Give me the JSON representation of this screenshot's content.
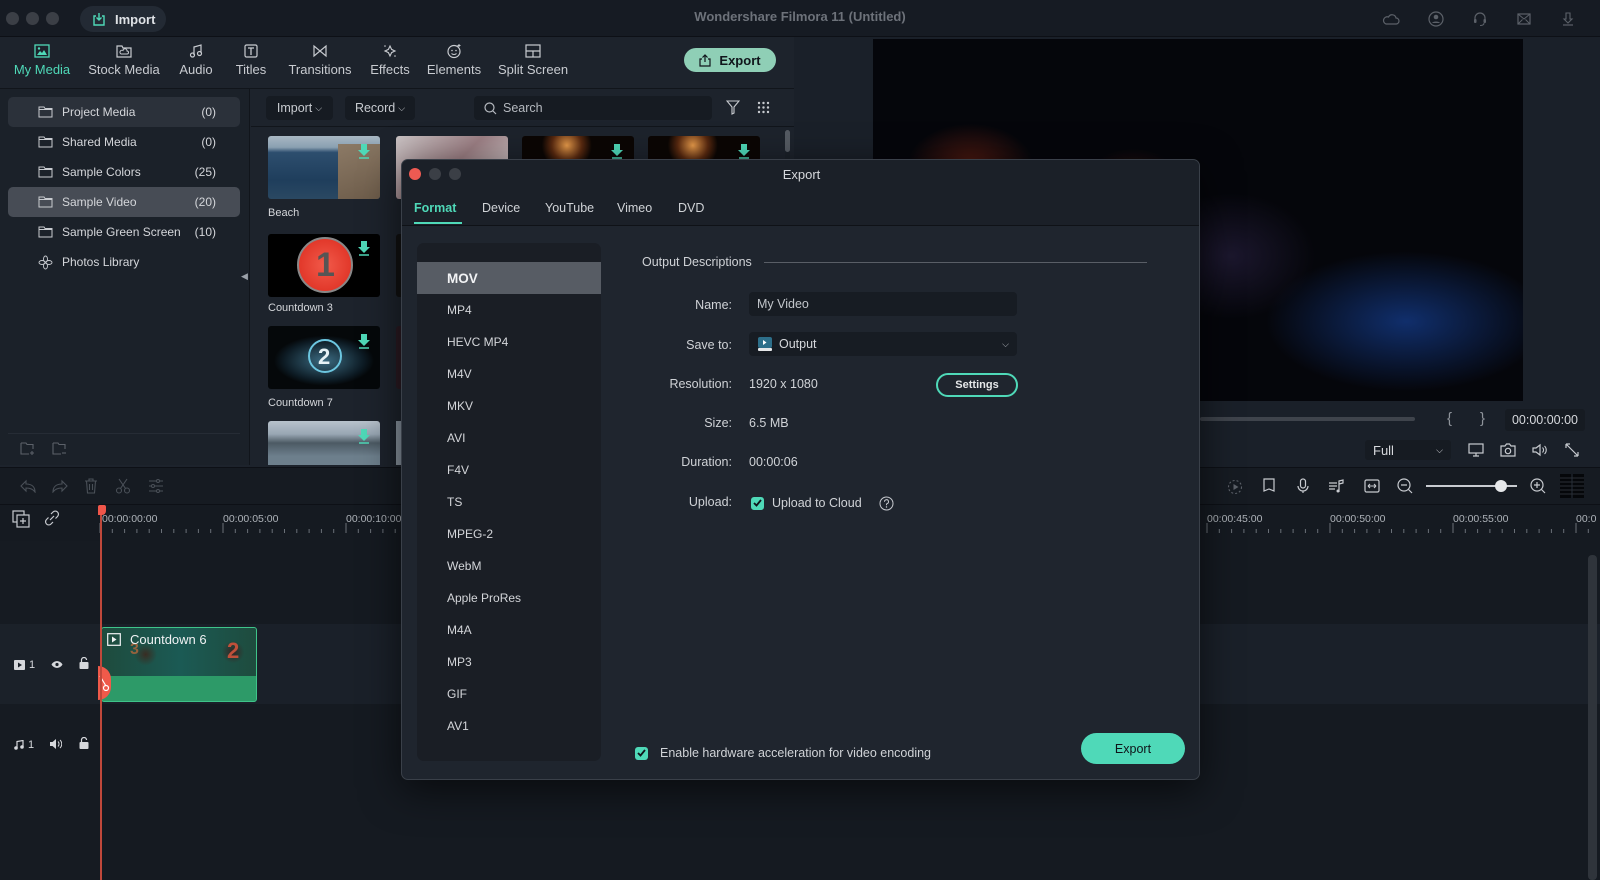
{
  "app": {
    "title": "Wondershare Filmora 11 (Untitled)",
    "import_label": "Import",
    "export_label": "Export"
  },
  "media_tabs": [
    {
      "label": "My Media",
      "icon": "image-icon",
      "active": true
    },
    {
      "label": "Stock Media",
      "icon": "cloud-folder-icon"
    },
    {
      "label": "Audio",
      "icon": "music-note-icon"
    },
    {
      "label": "Titles",
      "icon": "text-t-icon"
    },
    {
      "label": "Transitions",
      "icon": "transition-bowtie-icon"
    },
    {
      "label": "Effects",
      "icon": "sparkle-icon"
    },
    {
      "label": "Elements",
      "icon": "smiley-sticker-icon"
    },
    {
      "label": "Split Screen",
      "icon": "split-layout-icon"
    }
  ],
  "folders": [
    {
      "label": "Project Media",
      "count": "(0)"
    },
    {
      "label": "Shared Media",
      "count": "(0)"
    },
    {
      "label": "Sample Colors",
      "count": "(25)"
    },
    {
      "label": "Sample Video",
      "count": "(20)"
    },
    {
      "label": "Sample Green Screen",
      "count": "(10)"
    },
    {
      "label": "Photos Library",
      "count": ""
    }
  ],
  "media_toolbar": {
    "import_label": "Import",
    "record_label": "Record",
    "search_placeholder": "Search"
  },
  "media_items": [
    {
      "label": "Beach"
    },
    {
      "label": "Countdown 3"
    },
    {
      "label": "Countdown 7"
    }
  ],
  "preview": {
    "timecode": "00:00:00:00",
    "quality": "Full",
    "mark_in": "{",
    "mark_out": "}"
  },
  "timeline": {
    "ticks": [
      "00:00:00:00",
      "00:00:05:00",
      "00:00:10:00",
      "00:00:45:00",
      "00:00:50:00",
      "00:00:55:00",
      "00:0"
    ],
    "zoom_level": 0.82,
    "clip_label": "Countdown 6",
    "video_track": "1",
    "audio_track": "1"
  },
  "export_dialog": {
    "title": "Export",
    "tabs": [
      "Format",
      "Device",
      "YouTube",
      "Vimeo",
      "DVD"
    ],
    "active_tab": "Format",
    "formats": [
      "MOV",
      "MP4",
      "HEVC MP4",
      "M4V",
      "MKV",
      "AVI",
      "F4V",
      "TS",
      "MPEG-2",
      "WebM",
      "Apple ProRes",
      "M4A",
      "MP3",
      "GIF",
      "AV1"
    ],
    "selected_format": "MOV",
    "section_title": "Output Descriptions",
    "labels": {
      "name": "Name:",
      "save_to": "Save to:",
      "resolution": "Resolution:",
      "size": "Size:",
      "duration": "Duration:",
      "upload": "Upload:"
    },
    "values": {
      "name": "My Video",
      "save_to": "Output",
      "resolution": "1920 x 1080",
      "size": "6.5 MB",
      "duration": "00:00:06",
      "upload_label": "Upload to Cloud",
      "upload_checked": true
    },
    "settings_label": "Settings",
    "hw_accel_label": "Enable hardware acceleration for video encoding",
    "hw_accel_checked": true,
    "export_label": "Export"
  },
  "colors": {
    "accent": "#4fd9b8",
    "close_red": "#ee5a52",
    "clip_green": "#2d9a68",
    "playhead": "#f0564a"
  }
}
